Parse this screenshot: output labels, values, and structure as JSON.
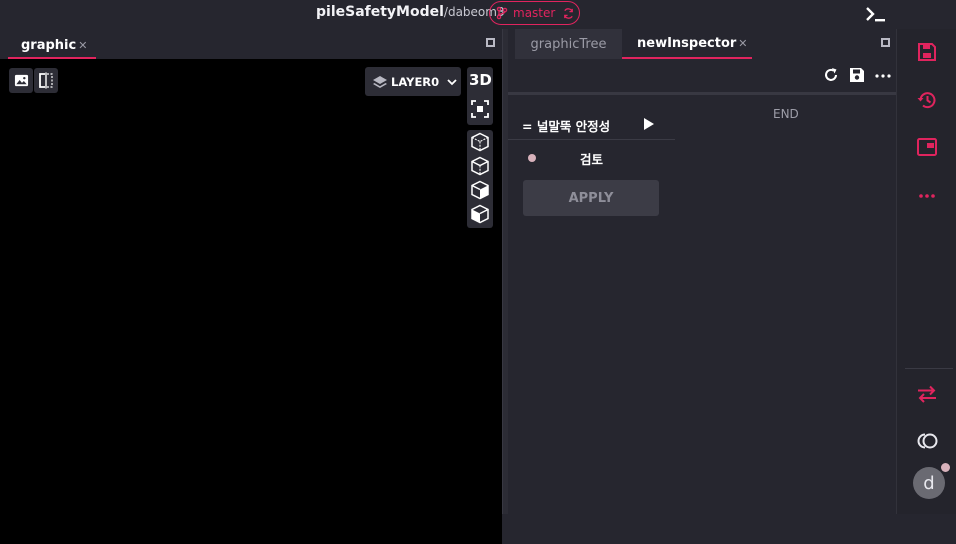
{
  "header": {
    "project": "pileSafetyModel",
    "user_path": "/dabeom3",
    "branch": "master"
  },
  "left_panel": {
    "tab_label": "graphic",
    "tab_close": "✕",
    "layer_label": "LAYER0",
    "view_mode": "3D"
  },
  "right_panel": {
    "tabs": [
      {
        "label": "graphicTree",
        "active": false
      },
      {
        "label": "newInspector",
        "active": true
      }
    ],
    "tab_close": "✕",
    "inspector": {
      "section_label": "= 널말뚝 안정성",
      "end_label": "END",
      "review_label": "검토",
      "apply_label": "APPLY"
    }
  },
  "sidebar": {
    "avatar_initial": "d",
    "icons": [
      "save-icon",
      "history-icon",
      "window-icon",
      "more-icon",
      "swap-icon",
      "toggle-icon"
    ]
  },
  "colors": {
    "accent": "#e0245e",
    "background": "#26262f",
    "viewport": "#000000"
  }
}
